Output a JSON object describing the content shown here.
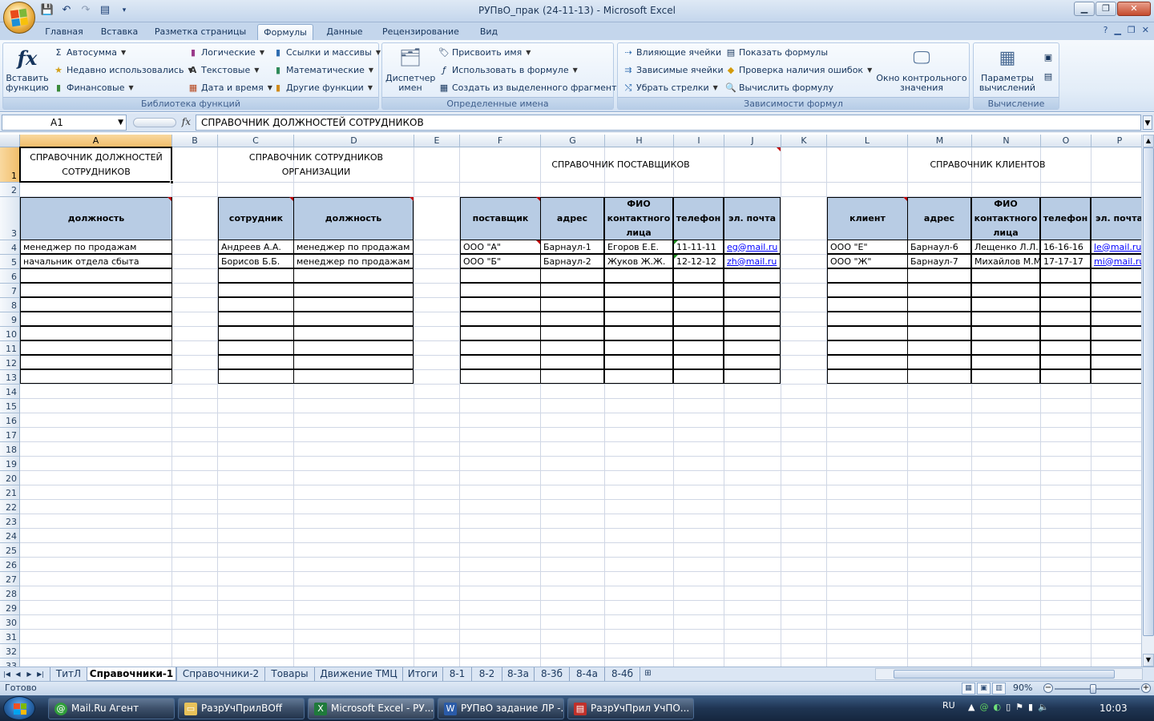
{
  "window": {
    "title": "РУПвО_прак (24-11-13) - Microsoft Excel"
  },
  "ribbon_tabs": [
    "Главная",
    "Вставка",
    "Разметка страницы",
    "Формулы",
    "Данные",
    "Рецензирование",
    "Вид"
  ],
  "active_tab": "Формулы",
  "ribbon": {
    "insert_function": "Вставить функцию",
    "autosum": "Автосумма",
    "recent": "Недавно использовались",
    "financial": "Финансовые",
    "logical": "Логические",
    "text": "Текстовые",
    "datetime": "Дата и время",
    "refs": "Ссылки и массивы",
    "math": "Математические",
    "other": "Другие функции",
    "library_label": "Библиотека функций",
    "name_manager": "Диспетчер имен",
    "assign_name": "Присвоить имя",
    "use_in_formula": "Использовать в формуле",
    "create_from_sel": "Создать из выделенного фрагмента",
    "names_label": "Определенные имена",
    "trace_precedents": "Влияющие ячейки",
    "trace_dependents": "Зависимые ячейки",
    "remove_arrows": "Убрать стрелки",
    "show_formulas": "Показать формулы",
    "error_check": "Проверка наличия ошибок",
    "evaluate": "Вычислить формулу",
    "watch_window": "Окно контрольного значения",
    "deps_label": "Зависимости формул",
    "calc_options": "Параметры вычислений",
    "calc_label": "Вычисление"
  },
  "formula_bar": {
    "name_box": "A1",
    "fx": "fx",
    "content": "СПРАВОЧНИК ДОЛЖНОСТЕЙ СОТРУДНИКОВ"
  },
  "columns": [
    "A",
    "B",
    "C",
    "D",
    "E",
    "F",
    "G",
    "H",
    "I",
    "J",
    "K",
    "L",
    "M",
    "N",
    "O",
    "P"
  ],
  "rows": [
    "1",
    "2",
    "3",
    "4",
    "5",
    "6",
    "7",
    "8",
    "9",
    "10",
    "11",
    "12",
    "13",
    "14",
    "15",
    "16",
    "17",
    "18",
    "19",
    "20",
    "21",
    "22",
    "23",
    "24",
    "25",
    "26",
    "27",
    "28",
    "29",
    "30",
    "31",
    "32",
    "33"
  ],
  "sheet": {
    "title_positions": "СПРАВОЧНИК ДОЛЖНОСТЕЙ СОТРУДНИКОВ",
    "title_employees": "СПРАВОЧНИК СОТРУДНИКОВ ОРГАНИЗАЦИИ",
    "title_suppliers": "СПРАВОЧНИК ПОСТАВЩИКОВ",
    "title_clients": "СПРАВОЧНИК КЛИЕНТОВ",
    "positions_header": "должность",
    "positions": [
      "менеджер по продажам",
      "начальник отдела сбыта"
    ],
    "employees_headers": [
      "сотрудник",
      "должность"
    ],
    "employees": [
      [
        "Андреев А.А.",
        "менеджер по продажам"
      ],
      [
        "Борисов Б.Б.",
        "менеджер по продажам"
      ]
    ],
    "suppliers_headers": [
      "поставщик",
      "адрес",
      "ФИО контактного лица",
      "телефон",
      "эл. почта"
    ],
    "suppliers": [
      [
        "ООО \"А\"",
        "Барнаул-1",
        "Егоров Е.Е.",
        "11-11-11",
        "eg@mail.ru"
      ],
      [
        "ООО \"Б\"",
        "Барнаул-2",
        "Жуков Ж.Ж.",
        "12-12-12",
        "zh@mail.ru"
      ]
    ],
    "clients_headers": [
      "клиент",
      "адрес",
      "ФИО контактного лица",
      "телефон",
      "эл. почта"
    ],
    "clients": [
      [
        "ООО \"Е\"",
        "Барнаул-6",
        "Лещенко Л.Л.",
        "16-16-16",
        "le@mail.ru"
      ],
      [
        "ООО \"Ж\"",
        "Барнаул-7",
        "Михайлов М.М.",
        "17-17-17",
        "mi@mail.ru"
      ]
    ]
  },
  "sheet_tabs": [
    "ТитЛ",
    "Справочники-1",
    "Справочники-2",
    "Товары",
    "Движение ТМЦ",
    "Итоги",
    "8-1",
    "8-2",
    "8-3а",
    "8-3б",
    "8-4а",
    "8-4б"
  ],
  "active_sheet": "Справочники-1",
  "status": {
    "ready": "Готово",
    "zoom": "90%",
    "zoom_fraction": 0.45
  },
  "taskbar": {
    "items": [
      "Mail.Ru Агент",
      "РазрУчПрилВOff",
      "Microsoft Excel - РУ...",
      "РУПвО задание ЛР -...",
      "РазрУчПрил УчПО..."
    ],
    "lang": "RU",
    "clock": "10:03"
  }
}
